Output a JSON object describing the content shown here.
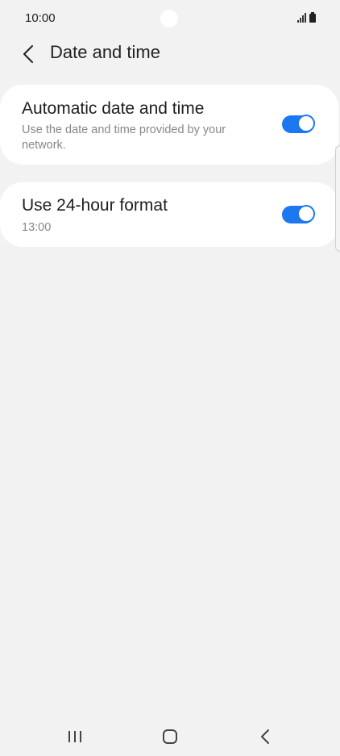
{
  "status_bar": {
    "time": "10:00",
    "icons": [
      "signal-icon",
      "battery-icon"
    ]
  },
  "header": {
    "title": "Date and time",
    "back_icon": "chevron-left-icon"
  },
  "settings": [
    {
      "title": "Automatic date and time",
      "subtitle": "Use the date and time provided by your network.",
      "enabled": true
    },
    {
      "title": "Use 24-hour format",
      "subtitle": "13:00",
      "enabled": true
    }
  ],
  "navigation": {
    "icons": [
      "recent-apps-icon",
      "home-icon",
      "back-icon"
    ]
  },
  "colors": {
    "background": "#f2f2f2",
    "card": "#ffffff",
    "accent": "#1b78f0",
    "subtitle": "#888888"
  }
}
